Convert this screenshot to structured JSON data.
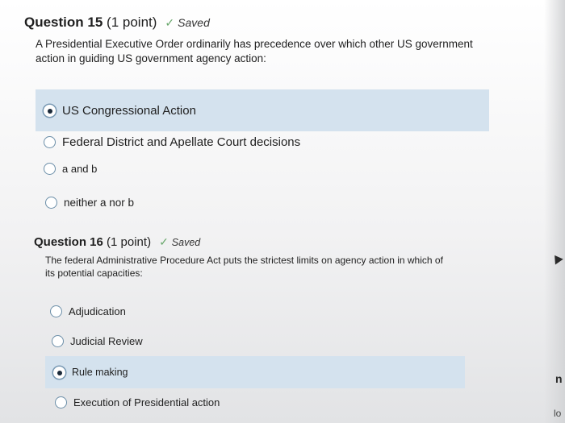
{
  "q15": {
    "title": "Question 15",
    "points": "(1 point)",
    "status": "Saved",
    "text_line1": "A Presidential Executive Order ordinarily has precedence over which other US government",
    "text_line2": "action in guiding US government agency action:",
    "options": [
      {
        "label": "US Congressional Action",
        "selected": true
      },
      {
        "label": "Federal District and Apellate Court decisions",
        "selected": false
      },
      {
        "label": "a and b",
        "selected": false
      },
      {
        "label": "neither a nor b",
        "selected": false
      }
    ]
  },
  "q16": {
    "title": "Question 16",
    "points": "(1 point)",
    "status": "Saved",
    "text_line1": "The federal Administrative Procedure Act puts the strictest limits on agency action in which of",
    "text_line2": "its potential capacities:",
    "options": [
      {
        "label": "Adjudication",
        "selected": false
      },
      {
        "label": "Judicial Review",
        "selected": false
      },
      {
        "label": "Rule making",
        "selected": true
      },
      {
        "label": "Execution of Presidential action",
        "selected": false
      }
    ]
  },
  "edge": {
    "right_letter": "n",
    "bottom_right": "lo"
  },
  "colors": {
    "selected_row": "#d4e2ee",
    "saved_check": "#6aa86d"
  }
}
